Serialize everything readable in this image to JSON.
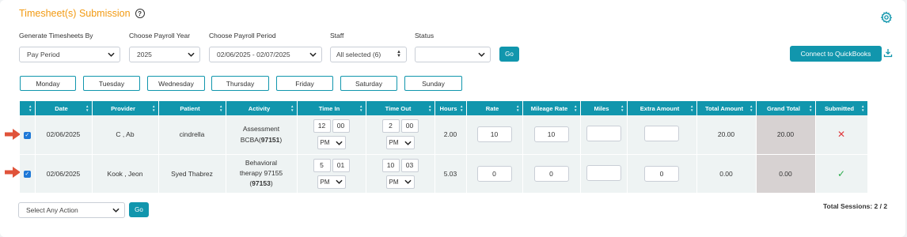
{
  "page": {
    "title": "Timesheet(s) Submission",
    "help_glyph": "?"
  },
  "filters": {
    "generate_by": {
      "label": "Generate Timesheets By",
      "value": "Pay Period"
    },
    "payroll_year": {
      "label": "Choose Payroll Year",
      "value": "2025"
    },
    "payroll_period": {
      "label": "Choose Payroll Period",
      "value": "02/06/2025 - 02/07/2025"
    },
    "staff": {
      "label": "Staff",
      "value": "All selected (6)"
    },
    "status": {
      "label": "Status",
      "value": ""
    },
    "go_label": "Go"
  },
  "quickbooks_label": "Connect to QuickBooks",
  "days": [
    "Monday",
    "Tuesday",
    "Wednesday",
    "Thursday",
    "Friday",
    "Saturday",
    "Sunday"
  ],
  "table": {
    "headers": [
      "",
      "Date",
      "Provider",
      "Patient",
      "Activity",
      "Time In",
      "Time Out",
      "Hours",
      "Rate",
      "Mileage Rate",
      "Miles",
      "Extra Amount",
      "Total Amount",
      "Grand Total",
      "Submitted"
    ],
    "rows": [
      {
        "checked": true,
        "date": "02/06/2025",
        "provider": "C , Ab",
        "patient": "cindrella",
        "activity_line1": "Assessment",
        "activity_line2_prefix": "BCBA(",
        "activity_code": "97151",
        "activity_line2_suffix": ")",
        "time_in": {
          "hour": "12",
          "minute": "00",
          "ampm": "PM"
        },
        "time_out": {
          "hour": "2",
          "minute": "00",
          "ampm": "PM"
        },
        "hours": "2.00",
        "rate": "10",
        "mileage_rate": "10",
        "miles": "",
        "extra_amount": "",
        "total_amount": "20.00",
        "grand_total": "20.00",
        "submitted_icon": "x-icon",
        "submitted_glyph": "✕"
      },
      {
        "checked": true,
        "date": "02/06/2025",
        "provider": "Kook , Jeon",
        "patient": "Syed Thabrez",
        "activity_line1": "Behavioral",
        "activity_line2": "therapy 97155",
        "activity_line3_prefix": "(",
        "activity_code": "97153",
        "activity_line3_suffix": ")",
        "time_in": {
          "hour": "5",
          "minute": "01",
          "ampm": "PM"
        },
        "time_out": {
          "hour": "10",
          "minute": "03",
          "ampm": "PM"
        },
        "hours": "5.03",
        "rate": "0",
        "mileage_rate": "0",
        "miles": "",
        "extra_amount": "0",
        "total_amount": "0.00",
        "grand_total": "0.00",
        "submitted_icon": "check-icon",
        "submitted_glyph": "✓"
      }
    ]
  },
  "bulk_action": {
    "value": "Select Any Action",
    "go_label": "Go"
  },
  "total_sessions": "Total Sessions: 2 / 2",
  "colors": {
    "accent": "#1196ad",
    "title": "#f29a12",
    "arrow": "#e0533a",
    "grand_total_bg": "#d7d2d2",
    "row_bg": "#eef3f3"
  }
}
